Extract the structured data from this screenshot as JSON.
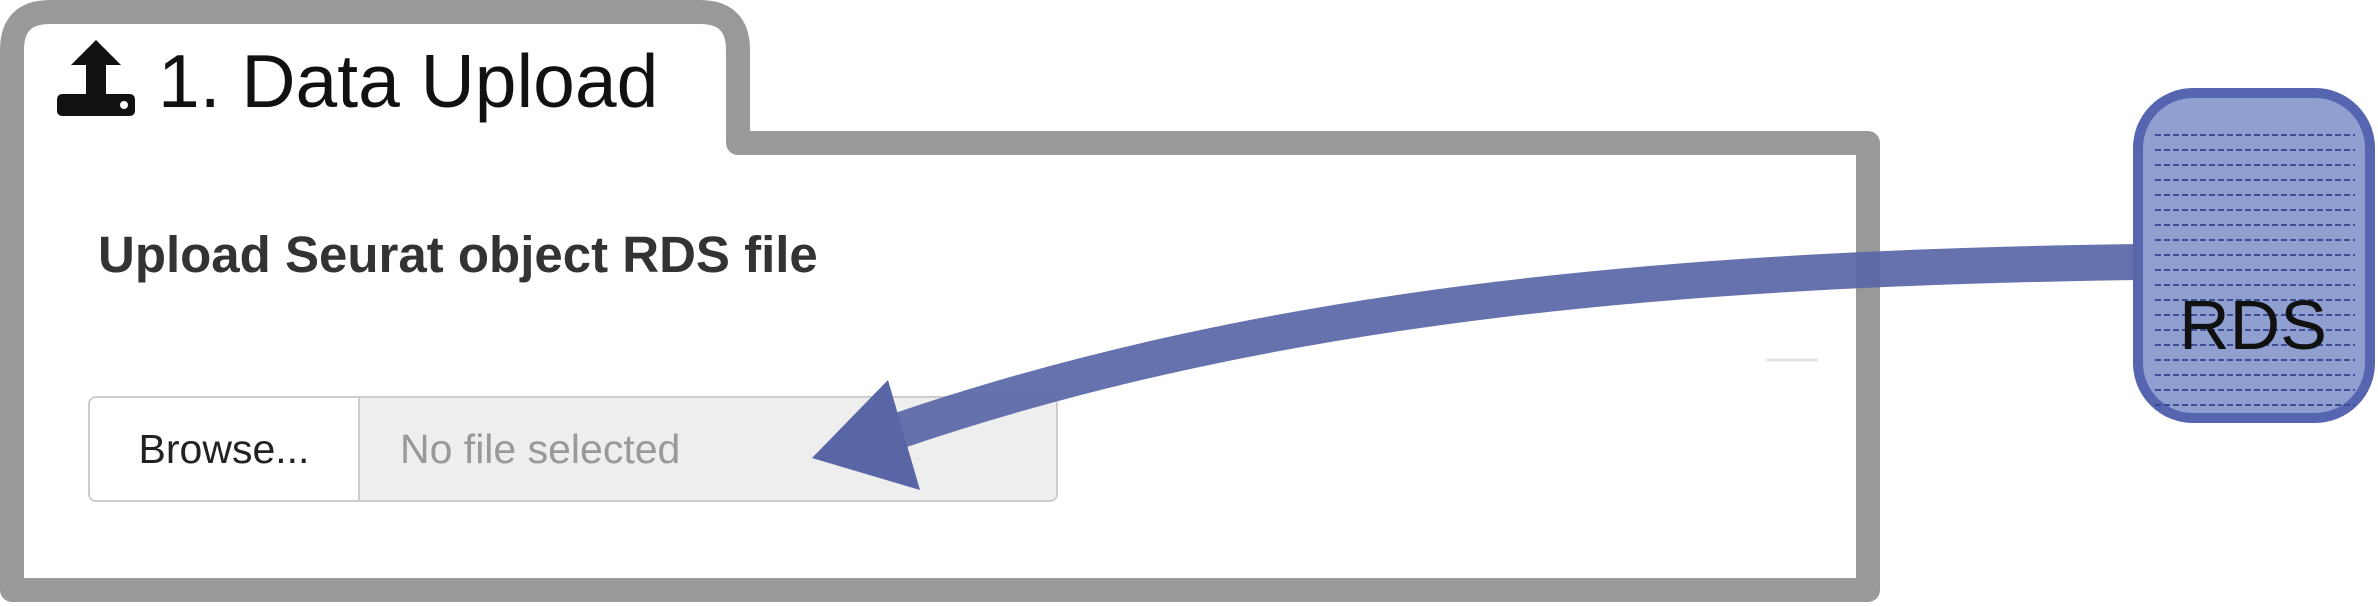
{
  "panel": {
    "tab_title": "1. Data Upload",
    "tab_icon": "upload-icon",
    "field_label": "Upload Seurat object RDS file",
    "file_input": {
      "button_label": "Browse...",
      "placeholder": "No file selected"
    }
  },
  "annotation": {
    "document_label": "RDS",
    "document_icon": "file-icon",
    "arrow_color": "#5866a6",
    "document_fill": "#8e9fd0",
    "document_border": "#5565b0"
  },
  "colors": {
    "panel_border": "#999999",
    "input_bg": "#eeeeee",
    "placeholder_text": "#999999"
  }
}
